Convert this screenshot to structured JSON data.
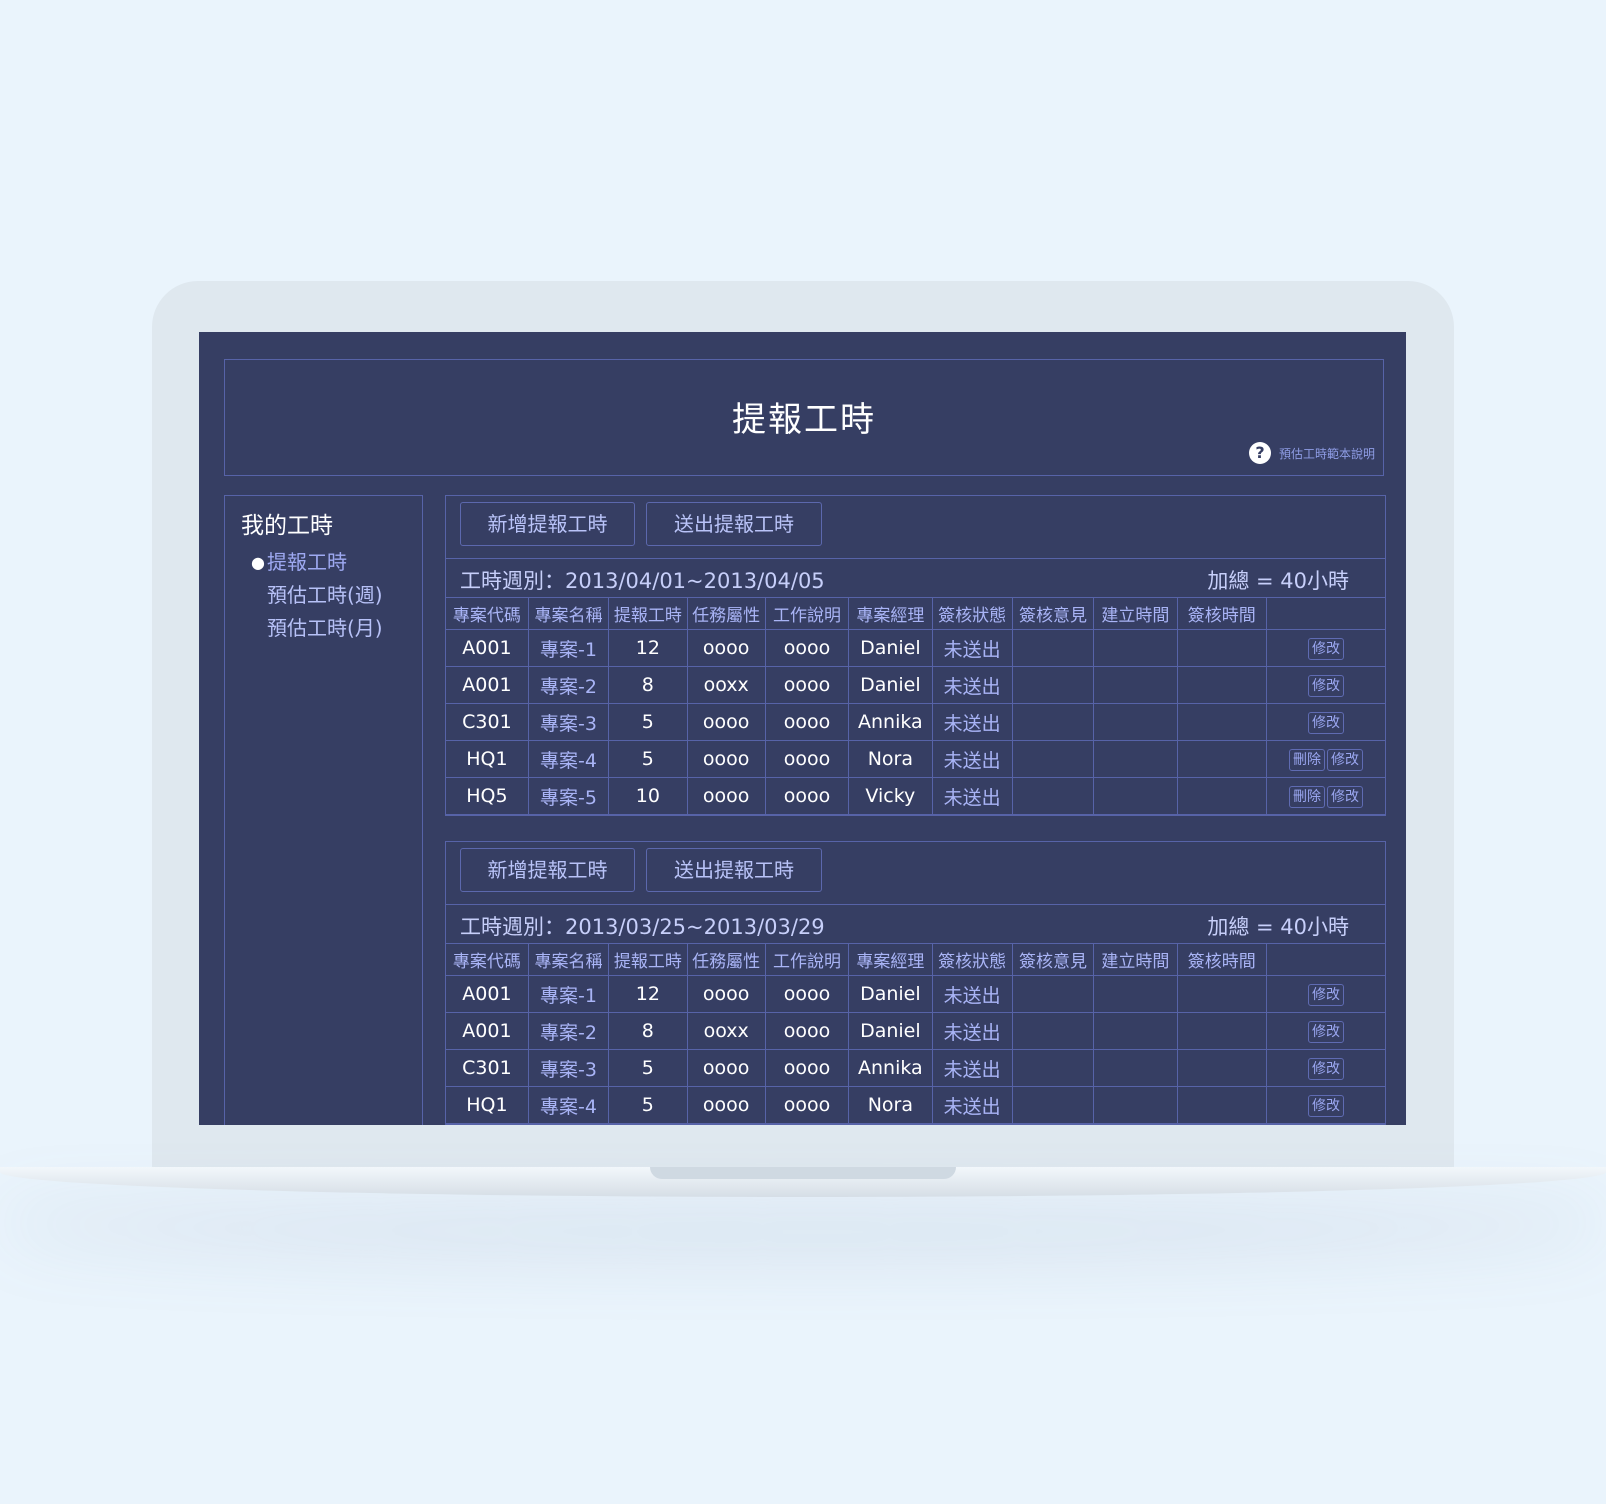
{
  "page": {
    "title": "提報工時",
    "help_link": "預估工時範本說明"
  },
  "sidebar": {
    "title": "我的工時",
    "items": [
      {
        "label": "提報工時",
        "active": true
      },
      {
        "label": "預估工時(週)",
        "active": false
      },
      {
        "label": "預估工時(月)",
        "active": false
      }
    ]
  },
  "table_headers": [
    "專案代碼",
    "專案名稱",
    "提報工時",
    "任務屬性",
    "工作說明",
    "專案經理",
    "簽核狀態",
    "簽核意見",
    "建立時間",
    "簽核時間",
    ""
  ],
  "buttons": {
    "add": "新增提報工時",
    "submit": "送出提報工時",
    "edit": "修改",
    "delete": "刪除"
  },
  "panels": [
    {
      "week": "工時週別：2013/04/01~2013/04/05",
      "total": "加總 = 40小時",
      "rows": [
        {
          "code": "A001",
          "name": "專案-1",
          "hours": "12",
          "task": "oooo",
          "desc": "oooo",
          "pm": "Daniel",
          "status": "未送出",
          "can_delete": false
        },
        {
          "code": "A001",
          "name": "專案-2",
          "hours": "8",
          "task": "ooxx",
          "desc": "oooo",
          "pm": "Daniel",
          "status": "未送出",
          "can_delete": false
        },
        {
          "code": "C301",
          "name": "專案-3",
          "hours": "5",
          "task": "oooo",
          "desc": "oooo",
          "pm": "Annika",
          "status": "未送出",
          "can_delete": false
        },
        {
          "code": "HQ1",
          "name": "專案-4",
          "hours": "5",
          "task": "oooo",
          "desc": "oooo",
          "pm": "Nora",
          "status": "未送出",
          "can_delete": true
        },
        {
          "code": "HQ5",
          "name": "專案-5",
          "hours": "10",
          "task": "oooo",
          "desc": "oooo",
          "pm": "Vicky",
          "status": "未送出",
          "can_delete": true
        }
      ]
    },
    {
      "week": "工時週別：2013/03/25~2013/03/29",
      "total": "加總 = 40小時",
      "rows": [
        {
          "code": "A001",
          "name": "專案-1",
          "hours": "12",
          "task": "oooo",
          "desc": "oooo",
          "pm": "Daniel",
          "status": "未送出",
          "can_delete": false
        },
        {
          "code": "A001",
          "name": "專案-2",
          "hours": "8",
          "task": "ooxx",
          "desc": "oooo",
          "pm": "Daniel",
          "status": "未送出",
          "can_delete": false
        },
        {
          "code": "C301",
          "name": "專案-3",
          "hours": "5",
          "task": "oooo",
          "desc": "oooo",
          "pm": "Annika",
          "status": "未送出",
          "can_delete": false
        },
        {
          "code": "HQ1",
          "name": "專案-4",
          "hours": "5",
          "task": "oooo",
          "desc": "oooo",
          "pm": "Nora",
          "status": "未送出",
          "can_delete": false
        }
      ]
    }
  ]
}
